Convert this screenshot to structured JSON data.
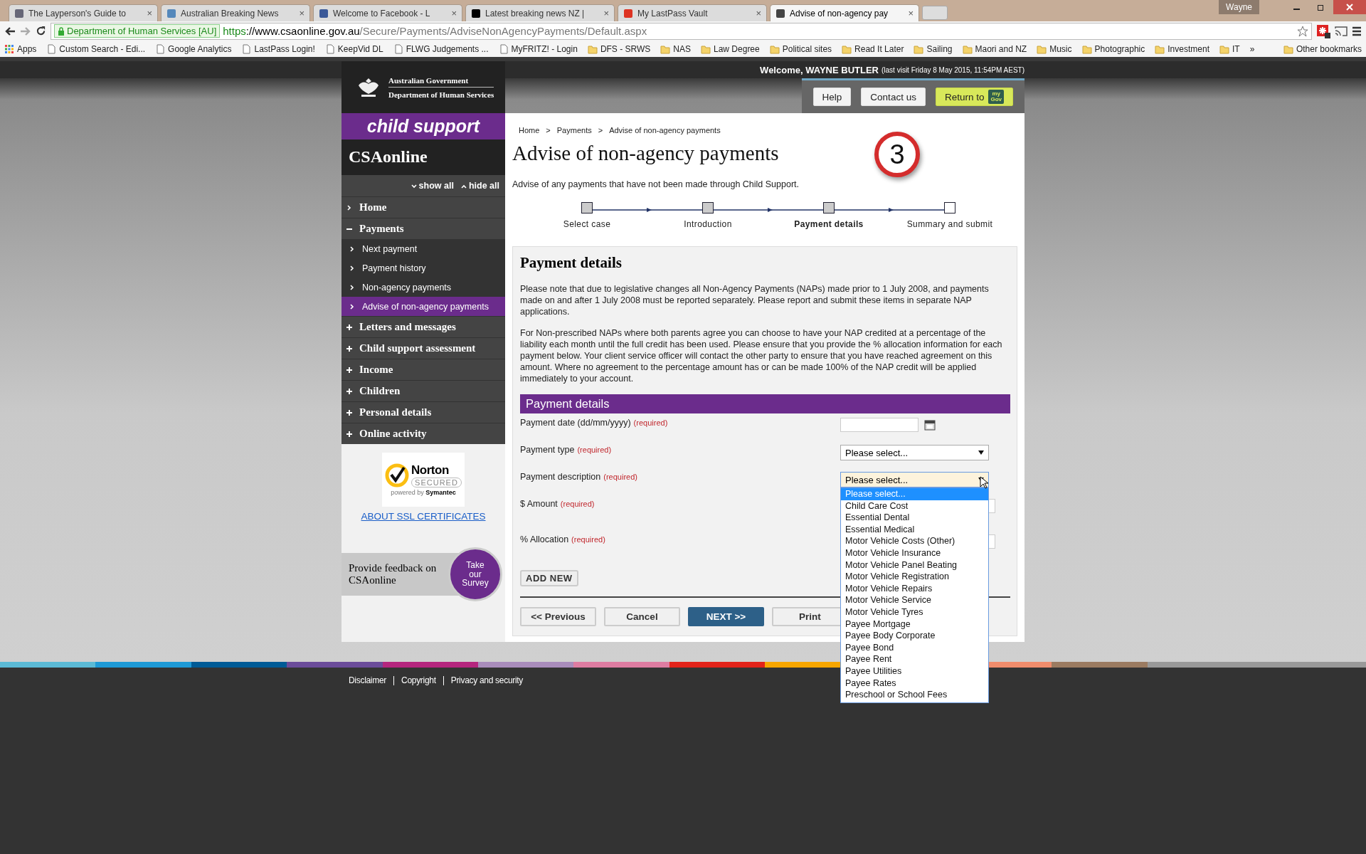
{
  "browser": {
    "tabs": [
      {
        "title": "The Layperson's Guide to",
        "selected": false
      },
      {
        "title": "Australian Breaking News",
        "selected": false
      },
      {
        "title": "Welcome to Facebook - L",
        "selected": false
      },
      {
        "title": "Latest breaking news NZ |",
        "selected": false
      },
      {
        "title": "My LastPass Vault",
        "selected": false
      },
      {
        "title": "Advise of non-agency pay",
        "selected": true
      }
    ],
    "profile": "Wayne",
    "tab_close": "×",
    "address": {
      "identity": "Department of Human Services [AU]",
      "scheme": "https",
      "host": "://www.csaonline.gov.au",
      "path": "/Secure/Payments/AdviseNonAgencyPayments/Default.aspx"
    },
    "bookmarks": [
      {
        "label": "Apps",
        "kind": "apps"
      },
      {
        "label": "Custom Search - Edi...",
        "kind": "page"
      },
      {
        "label": "Google Analytics",
        "kind": "page"
      },
      {
        "label": "LastPass Login!",
        "kind": "page"
      },
      {
        "label": "KeepVid DL",
        "kind": "page"
      },
      {
        "label": "FLWG Judgements ...",
        "kind": "page"
      },
      {
        "label": "MyFRITZ! - Login",
        "kind": "page"
      },
      {
        "label": "DFS - SRWS",
        "kind": "folder"
      },
      {
        "label": "NAS",
        "kind": "folder"
      },
      {
        "label": "Law Degree",
        "kind": "folder"
      },
      {
        "label": "Political sites",
        "kind": "folder"
      },
      {
        "label": "Read It Later",
        "kind": "folder"
      },
      {
        "label": "Sailing",
        "kind": "folder"
      },
      {
        "label": "Maori and NZ",
        "kind": "folder"
      },
      {
        "label": "Music",
        "kind": "folder"
      },
      {
        "label": "Photographic",
        "kind": "folder"
      },
      {
        "label": "Investment",
        "kind": "folder"
      },
      {
        "label": "IT",
        "kind": "folder"
      },
      {
        "label": "»",
        "kind": "overflow"
      },
      {
        "label": "Other bookmarks",
        "kind": "folder"
      }
    ]
  },
  "header": {
    "agency": [
      "Australian Government",
      "Department of Human Services"
    ],
    "welcome": "Welcome, WAYNE BUTLER",
    "last_visit": "(last visit Friday 8 May 2015, 11:54PM AEST)",
    "buttons": [
      {
        "label": "Help",
        "kind": "plain"
      },
      {
        "label": "Contact us",
        "kind": "plain"
      },
      {
        "label": "Return to",
        "kind": "mygov",
        "badge": [
          "my",
          "Gov"
        ]
      }
    ]
  },
  "sidebar": {
    "banner": "child support",
    "site_name": "CSAonline",
    "show_all": "show all",
    "hide_all": "hide all",
    "nav": [
      {
        "label": "Home",
        "kind": "link"
      },
      {
        "label": "Payments",
        "kind": "section",
        "expanded": true,
        "children": [
          {
            "label": "Next payment",
            "selected": false
          },
          {
            "label": "Payment history",
            "selected": false
          },
          {
            "label": "Non-agency payments",
            "selected": false
          },
          {
            "label": "Advise of non-agency payments",
            "selected": true
          }
        ]
      },
      {
        "label": "Letters and messages",
        "kind": "section",
        "expanded": false
      },
      {
        "label": "Child support assessment",
        "kind": "section",
        "expanded": false
      },
      {
        "label": "Income",
        "kind": "section",
        "expanded": false
      },
      {
        "label": "Children",
        "kind": "section",
        "expanded": false
      },
      {
        "label": "Personal details",
        "kind": "section",
        "expanded": false
      },
      {
        "label": "Online activity",
        "kind": "section",
        "expanded": false
      }
    ],
    "norton": {
      "name": "Norton",
      "secured": "SECURED",
      "powered": "powered by",
      "vendor": "Symantec"
    },
    "ssl_link": "ABOUT SSL CERTIFICATES",
    "feedback": {
      "text": "Provide feedback on CSAonline",
      "badge": "Take our Survey"
    }
  },
  "main": {
    "breadcrumbs": [
      "Home",
      "Payments",
      "Advise of non-agency payments"
    ],
    "separator": ">",
    "title": "Advise of non-agency payments",
    "step_badge": "3",
    "intro": "Advise of any payments that have not been made through Child Support.",
    "steps": [
      {
        "label": "Select case",
        "done": true,
        "current": false
      },
      {
        "label": "Introduction",
        "done": true,
        "current": false
      },
      {
        "label": "Payment details",
        "done": true,
        "current": true
      },
      {
        "label": "Summary and submit",
        "done": false,
        "current": false
      }
    ],
    "panel": {
      "title": "Payment details",
      "paragraphs": [
        "Please note that due to legislative changes all Non-Agency Payments (NAPs) made prior to 1 July 2008, and payments made on and after 1 July 2008 must be reported separately. Please report and submit these items in separate NAP applications.",
        "For Non-prescribed NAPs where both parents agree you can choose to have your NAP credited at a percentage of the liability each month until the full credit has been used. Please ensure that you provide the % allocation information for each payment below. Your client service officer will contact the other party to ensure that you have reached agreement on this amount. Where no agreement to the percentage amount has or can be made 100% of the NAP credit will be applied immediately to your account."
      ],
      "section_title": "Payment details",
      "fields": [
        {
          "label": "Payment date (dd/mm/yyyy)",
          "required": "(required)",
          "kind": "date"
        },
        {
          "label": "Payment type",
          "required": "(required)",
          "kind": "select",
          "value": "Please select...",
          "open": false
        },
        {
          "label": "Payment description",
          "required": "(required)",
          "kind": "select",
          "value": "Please select...",
          "open": true,
          "options": [
            {
              "label": "Please select...",
              "selected": true
            },
            {
              "label": "Child Care Cost",
              "selected": false
            },
            {
              "label": "Essential Dental",
              "selected": false
            },
            {
              "label": "Essential Medical",
              "selected": false
            },
            {
              "label": "Motor Vehicle Costs (Other)",
              "selected": false
            },
            {
              "label": "Motor Vehicle Insurance",
              "selected": false
            },
            {
              "label": "Motor Vehicle Panel Beating",
              "selected": false
            },
            {
              "label": "Motor Vehicle Registration",
              "selected": false
            },
            {
              "label": "Motor Vehicle Repairs",
              "selected": false
            },
            {
              "label": "Motor Vehicle Service",
              "selected": false
            },
            {
              "label": "Motor Vehicle Tyres",
              "selected": false
            },
            {
              "label": "Payee Mortgage",
              "selected": false
            },
            {
              "label": "Payee Body Corporate",
              "selected": false
            },
            {
              "label": "Payee Bond",
              "selected": false
            },
            {
              "label": "Payee Rent",
              "selected": false
            },
            {
              "label": "Payee Utilities",
              "selected": false
            },
            {
              "label": "Payee Rates",
              "selected": false
            },
            {
              "label": "Preschool or School Fees",
              "selected": false
            }
          ]
        },
        {
          "label": "$ Amount",
          "required": "(required)",
          "kind": "text"
        },
        {
          "label": "% Allocation",
          "required": "(required)",
          "kind": "text"
        }
      ],
      "add_button": "ADD NEW",
      "buttons": [
        {
          "label": "<< Previous",
          "kind": "secondary"
        },
        {
          "label": "Cancel",
          "kind": "secondary"
        },
        {
          "label": "NEXT >>",
          "kind": "primary"
        },
        {
          "label": "Print",
          "kind": "secondary"
        }
      ]
    }
  },
  "footer": {
    "links": [
      "Disclaimer",
      "Copyright",
      "Privacy and security"
    ]
  }
}
